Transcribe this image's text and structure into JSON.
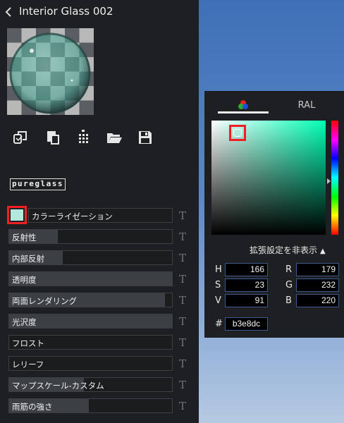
{
  "header": {
    "title": "Interior Glass 002",
    "back_icon": "chevron-left-icon"
  },
  "toolbar": [
    {
      "name": "duplicate-icon",
      "icon": "copy-layers-icon"
    },
    {
      "name": "paste-icon",
      "icon": "clipboard-icon"
    },
    {
      "name": "drip-icon",
      "icon": "dots-grid-icon"
    },
    {
      "name": "folder-icon",
      "icon": "open-folder-icon"
    },
    {
      "name": "save-icon",
      "icon": "floppy-disk-icon"
    }
  ],
  "logo": {
    "text": "pureglass"
  },
  "swatch": {
    "color": "#b3e8dc"
  },
  "properties": [
    {
      "label": "カラーライゼーション",
      "fill": 0.0
    },
    {
      "label": "反射性",
      "fill": 0.3
    },
    {
      "label": "内部反射",
      "fill": 0.33
    },
    {
      "label": "透明度",
      "fill": 1.0
    },
    {
      "label": "両面レンダリング",
      "fill": 0.955
    },
    {
      "label": "光沢度",
      "fill": 1.0
    },
    {
      "label": "フロスト",
      "fill": 0.0
    },
    {
      "label": "レリーフ",
      "fill": 0.0
    },
    {
      "label": "マップスケール-カスタム",
      "fill": 0.46
    },
    {
      "label": "雨筋の強さ",
      "fill": 0.49
    }
  ],
  "t_icon": "T",
  "picker": {
    "tabs": {
      "wheel_icon": "color-wheel-icon",
      "ral": "RAL"
    },
    "hue_color": "#00ffb5",
    "advanced_label": "拡張設定を非表示",
    "fields": {
      "H": {
        "label": "H",
        "value": "166"
      },
      "S": {
        "label": "S",
        "value": "23"
      },
      "V": {
        "label": "V",
        "value": "91"
      },
      "R": {
        "label": "R",
        "value": "179"
      },
      "G": {
        "label": "G",
        "value": "232"
      },
      "B": {
        "label": "B",
        "value": "220"
      }
    },
    "hex": {
      "label": "#",
      "value": "b3e8dc"
    }
  }
}
